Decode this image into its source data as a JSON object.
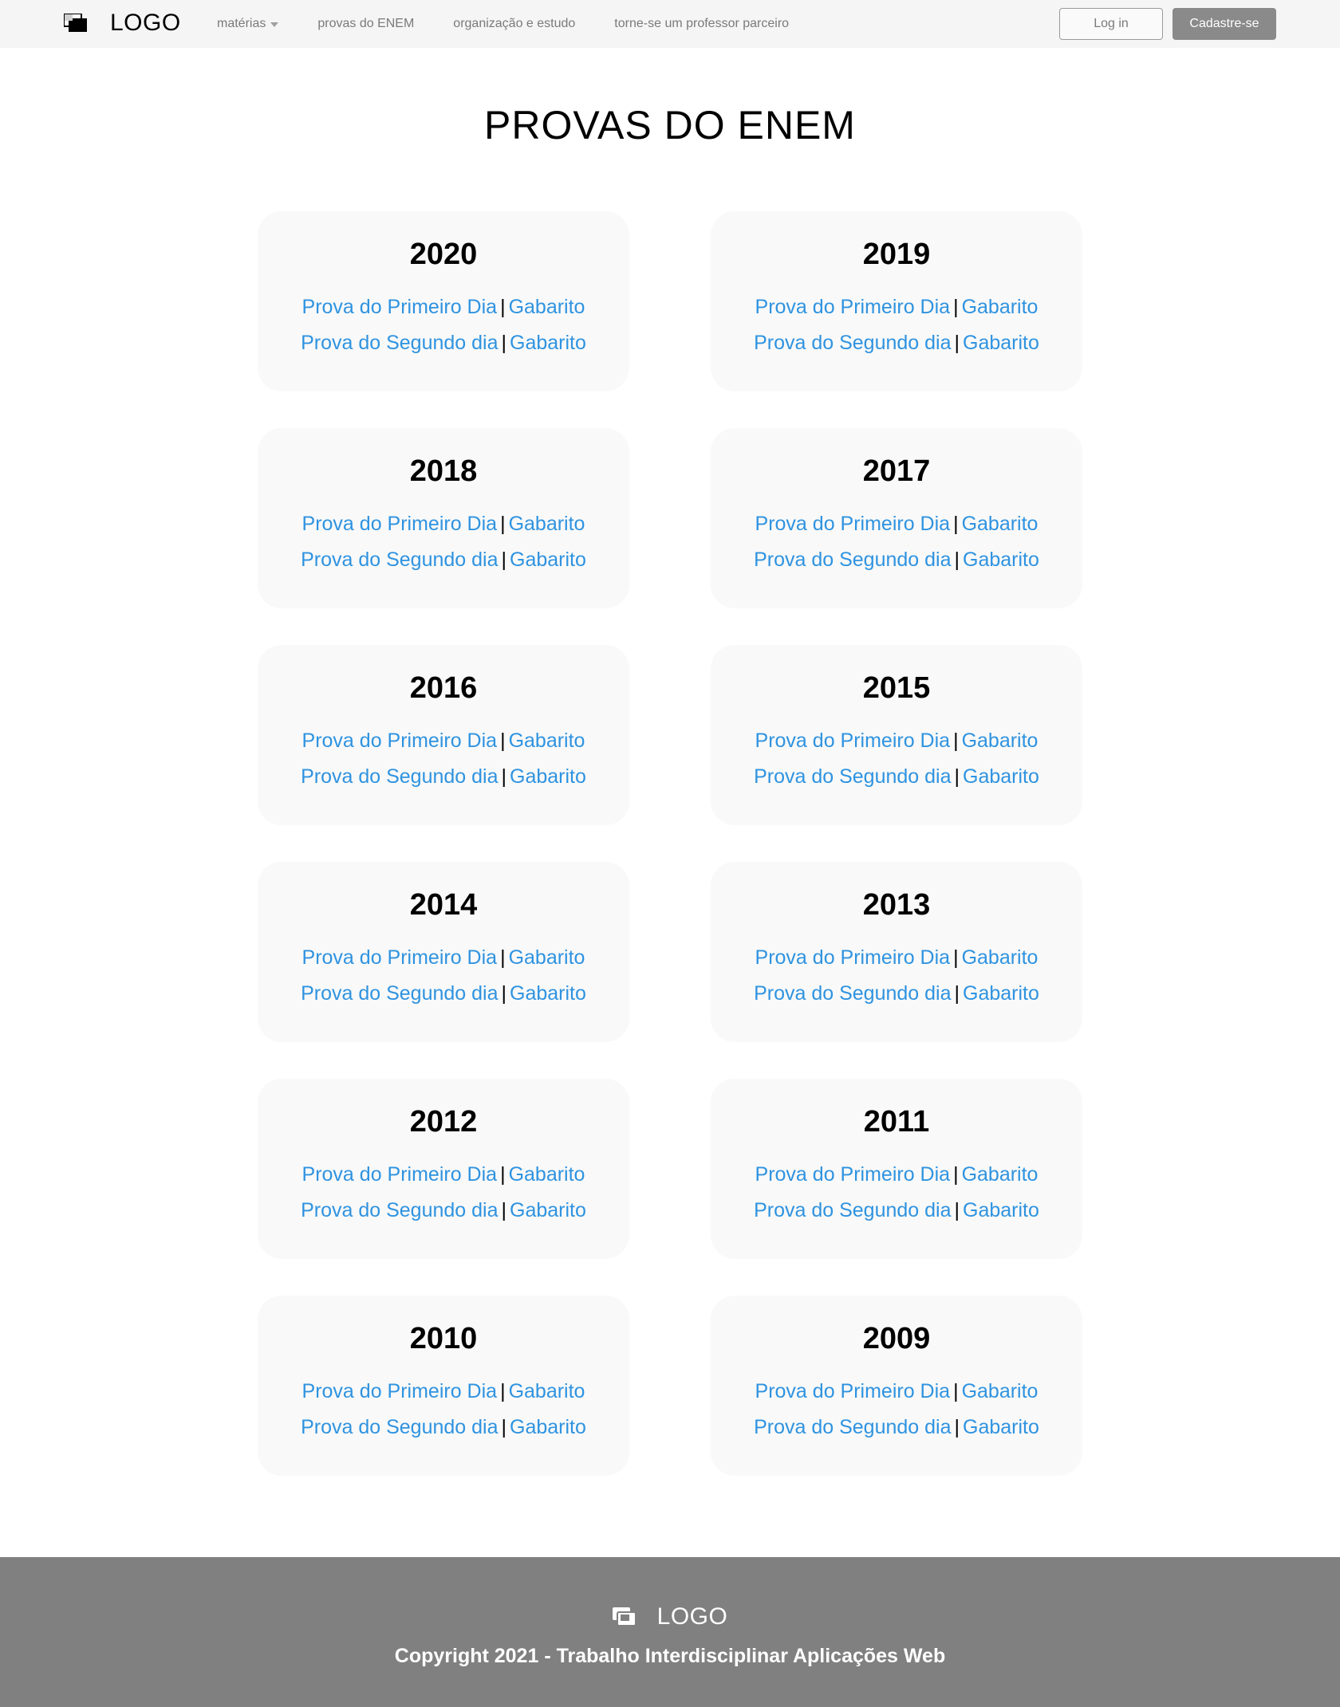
{
  "header": {
    "logo_text": "LOGO",
    "nav": [
      {
        "label": "matérias",
        "has_dropdown": true
      },
      {
        "label": "provas do ENEM"
      },
      {
        "label": "organização e estudo"
      },
      {
        "label": "torne-se um professor parceiro"
      }
    ],
    "login_label": "Log in",
    "signup_label": "Cadastre-se"
  },
  "page_title": "PROVAS DO ENEM",
  "link_labels": {
    "day1": "Prova do Primeiro Dia",
    "day2": "Prova do Segundo dia",
    "answer_key": "Gabarito",
    "separator": "|"
  },
  "cards": [
    {
      "year": "2020"
    },
    {
      "year": "2019"
    },
    {
      "year": "2018"
    },
    {
      "year": "2017"
    },
    {
      "year": "2016"
    },
    {
      "year": "2015"
    },
    {
      "year": "2014"
    },
    {
      "year": "2013"
    },
    {
      "year": "2012"
    },
    {
      "year": "2011"
    },
    {
      "year": "2010"
    },
    {
      "year": "2009"
    }
  ],
  "footer": {
    "logo_text": "LOGO",
    "copyright": "Copyright 2021 - Trabalho Interdisciplinar Aplicações Web"
  },
  "colors": {
    "link": "#2f93e0",
    "header_bg": "#f5f5f5",
    "footer_bg": "#808080",
    "card_bg": "#f9f9f9",
    "signup_bg": "#8a8a8a"
  }
}
